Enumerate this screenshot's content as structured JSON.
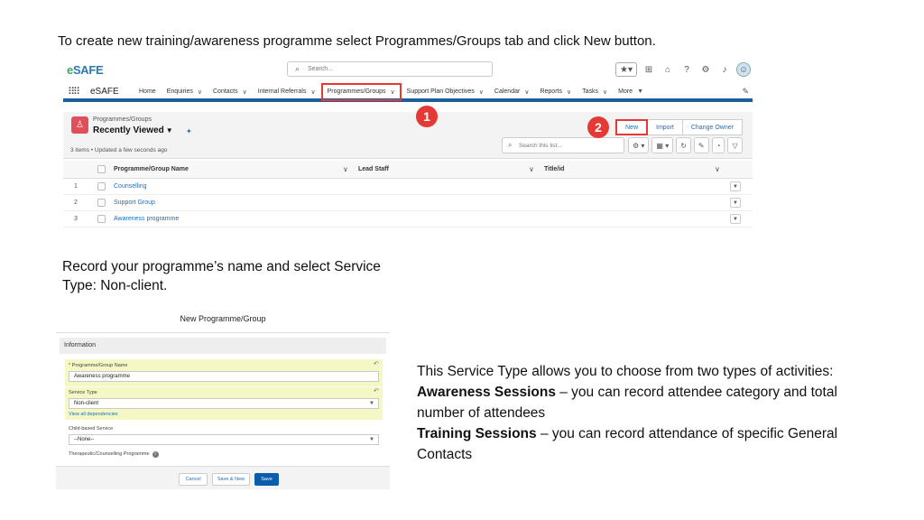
{
  "instruction_1": "To create new training/awareness programme select Programmes/Groups tab and click New button.",
  "instruction_2": "Record your programme’s name and select Service Type: Non-client.",
  "description": {
    "intro": "This Service Type allows you to choose from two types of activities:",
    "awareness_term": "Awareness Sessions",
    "awareness_text": " – you can record attendee category and total number of attendees",
    "training_term": "Training Sessions",
    "training_text": " – you can record attendance of specific General Contacts"
  },
  "colors": {
    "accent_red": "#e53935",
    "nav_blue": "#1d5f9a",
    "link_blue": "#1b6ec2",
    "highlight_yellow": "#f5f7c4",
    "primary_button": "#0b5cab"
  },
  "screenshot_list": {
    "logo": {
      "prefix": "e",
      "rest": "SAFE"
    },
    "search_placeholder": "Search...",
    "app_name": "eSAFE",
    "nav": [
      {
        "label": "Home",
        "chevron": ""
      },
      {
        "label": "Enquiries",
        "chevron": "∨"
      },
      {
        "label": "Contacts",
        "chevron": "∨"
      },
      {
        "label": "Internal Referrals",
        "chevron": "∨"
      },
      {
        "label": "Programmes/Groups",
        "chevron": "∨"
      },
      {
        "label": "Support Plan Objectives",
        "chevron": "∨"
      },
      {
        "label": "Calendar",
        "chevron": "∨"
      },
      {
        "label": "Reports",
        "chevron": "∨"
      },
      {
        "label": "Tasks",
        "chevron": "∨"
      },
      {
        "label": "More",
        "chevron": "▼"
      }
    ],
    "object_label": "Programmes/Groups",
    "view_name": "Recently Viewed",
    "meta": "3 items • Updated a few seconds ago",
    "buttons": {
      "new": "New",
      "import": "Import",
      "change_owner": "Change Owner"
    },
    "list_search_placeholder": "Search this list...",
    "columns": [
      "Programme/Group Name",
      "Lead Staff",
      "Title/id"
    ],
    "rows": [
      {
        "num": "1",
        "name": "Counselling"
      },
      {
        "num": "2",
        "name": "Support Group"
      },
      {
        "num": "3",
        "name": "Awareness programme"
      }
    ],
    "step_badges": [
      "1",
      "2"
    ],
    "icons": {
      "search": "search-icon",
      "favorites": "star-icon",
      "add": "plus-icon",
      "setup": "gear-icon",
      "help": "help-icon",
      "notifications": "bell-icon",
      "avatar": "user-avatar-icon",
      "waffle": "app-launcher-icon",
      "edit": "pencil-icon",
      "pin": "pin-icon"
    }
  },
  "screenshot_form": {
    "title": "New Programme/Group",
    "section": "Information",
    "fields": {
      "name_label": "Programme/Group Name",
      "name_value": "Awareness programme",
      "service_type_label": "Service Type",
      "service_type_value": "Non-client",
      "dependencies_link": "View all dependencies",
      "child_based_label": "Child-based Service",
      "child_based_value": "--None--",
      "therapeutic_label": "Therapeutic/Counselling Programme"
    },
    "buttons": {
      "cancel": "Cancel",
      "save_new": "Save & New",
      "save": "Save"
    }
  }
}
